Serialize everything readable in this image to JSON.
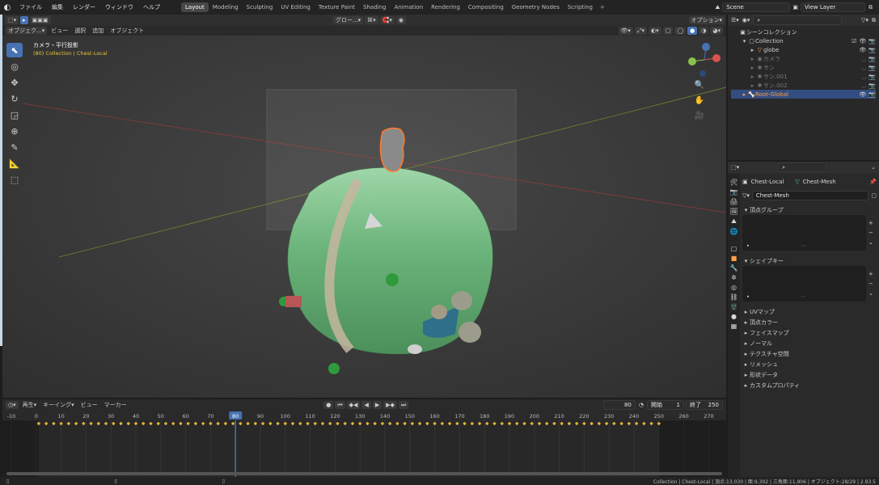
{
  "topbar": {
    "menus": [
      "ファイル",
      "編集",
      "レンダー",
      "ウィンドウ",
      "ヘルプ"
    ],
    "workspaces": [
      "Layout",
      "Modeling",
      "Sculpting",
      "UV Editing",
      "Texture Paint",
      "Shading",
      "Animation",
      "Rendering",
      "Compositing",
      "Geometry Nodes",
      "Scripting"
    ],
    "active_workspace": "Layout",
    "scene": "Scene",
    "view_layer": "View Layer"
  },
  "viewport": {
    "header": [
      "オブジェク...",
      "ビュー",
      "選択",
      "追加",
      "オブジェクト"
    ],
    "transform": "グロー...",
    "options": "オプション",
    "title": "カメラ・平行投影",
    "subtitle": "(80) Collection | Chest-Local"
  },
  "outliner": {
    "root": "シーンコレクション",
    "collection": "Collection",
    "items": [
      "globe",
      "カメラ",
      "サン",
      "サン.001",
      "サン.002"
    ],
    "selected": "Root-Global"
  },
  "properties": {
    "object": "Chest-Local",
    "mesh": "Chest-Mesh",
    "mesh_field": "Chest-Mesh",
    "vertex_groups": "頂点グループ",
    "shape_keys": "シェイプキー",
    "sections": [
      "UVマップ",
      "頂点カラー",
      "フェイスマップ",
      "ノーマル",
      "テクスチャ空間",
      "リメッシュ",
      "形状データ",
      "カスタムプロパティ"
    ]
  },
  "timeline": {
    "menus": [
      "再生",
      "キーイング",
      "ビュー",
      "マーカー"
    ],
    "current": "80",
    "start_label": "開始",
    "start": "1",
    "end_label": "終了",
    "end": "250",
    "ticks": [
      "-10",
      "0",
      "10",
      "20",
      "30",
      "40",
      "50",
      "60",
      "70",
      "80",
      "90",
      "100",
      "110",
      "120",
      "130",
      "140",
      "150",
      "160",
      "170",
      "180",
      "190",
      "200",
      "210",
      "220",
      "230",
      "240",
      "250",
      "260",
      "270"
    ]
  },
  "status": "Collection | Chest-Local | 頂点:13,030 | 面:9,302 | 三角面:11,906 | オブジェクト:28/29 | 2.93.5",
  "colors": {
    "accent": "#4772b3",
    "selected": "#ff9f47",
    "subtitle": "#e8c53a"
  }
}
